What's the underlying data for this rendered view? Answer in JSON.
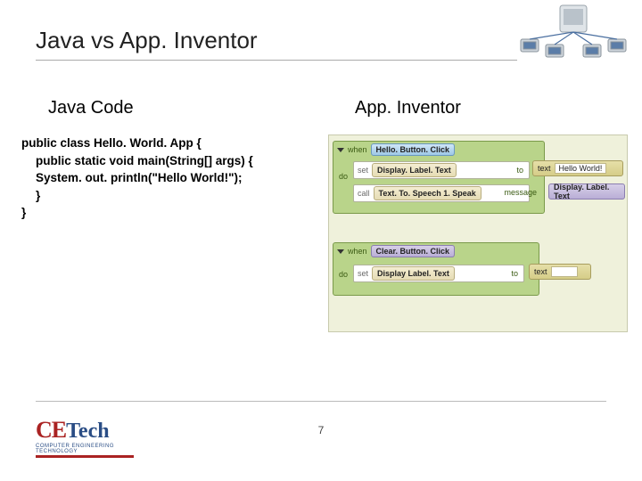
{
  "slide": {
    "title": "Java vs App. Inventor",
    "page_number": "7"
  },
  "left": {
    "heading": "Java Code",
    "code": {
      "l1": "public class Hello. World. App {",
      "l2": "public static void main(String[] args) {",
      "l3": "System. out. println(\"Hello World!\");",
      "l4": "}",
      "l5": "}"
    }
  },
  "right": {
    "heading": "App. Inventor",
    "block1": {
      "when": "when",
      "event": "Hello. Button. Click",
      "do": "do",
      "set": "set",
      "slot1": "Display. Label. Text",
      "to": "to",
      "text_label": "text",
      "text_value": "Hello World!",
      "call": "call",
      "slot2": "Text. To. Speech 1. Speak",
      "message": "message",
      "value_label": "Display. Label. Text"
    },
    "block2": {
      "when": "when",
      "event": "Clear. Button. Click",
      "do": "do",
      "set": "set",
      "slot1": "Display Label. Text",
      "to": "to",
      "text_label": "text",
      "text_value": ""
    }
  },
  "logo": {
    "ce": "CE",
    "tech": "Tech",
    "sub": "COMPUTER ENGINEERING TECHNOLOGY"
  }
}
